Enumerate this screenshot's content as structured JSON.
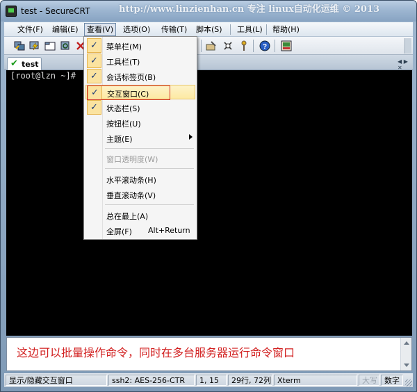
{
  "window": {
    "title": "test - SecureCRT",
    "watermark": "http://www.linzienhan.cn   专注 linux自动化运维 © 2013"
  },
  "menubar": {
    "items": [
      {
        "label": "文件(F)"
      },
      {
        "label": "编辑(E)"
      },
      {
        "label": "查看(V)"
      },
      {
        "label": "选项(O)"
      },
      {
        "label": "传输(T)"
      },
      {
        "label": "脚本(S)"
      },
      {
        "label": "工具(L)"
      },
      {
        "label": "帮助(H)"
      }
    ],
    "active_index": 2
  },
  "toolbar": {
    "icons": [
      "connect-icon",
      "quick-connect-icon",
      "connect-in-tab-icon",
      "reconnect-icon",
      "disconnect-icon",
      "options-icon",
      "key-icon",
      "help-icon",
      "keymap-icon"
    ]
  },
  "tabs": [
    {
      "label": "test",
      "status": "connected"
    }
  ],
  "terminal": {
    "prompt": "[root@lzn ~]#"
  },
  "view_menu": {
    "items": [
      {
        "type": "item",
        "label": "菜单栏(M)",
        "checked": true
      },
      {
        "type": "item",
        "label": "工具栏(T)",
        "checked": true
      },
      {
        "type": "item",
        "label": "会话标签页(B)",
        "checked": true
      },
      {
        "type": "item",
        "label": "交互窗口(C)",
        "checked": true,
        "highlighted": true
      },
      {
        "type": "item",
        "label": "状态栏(S)",
        "checked": true
      },
      {
        "type": "item",
        "label": "按钮栏(U)",
        "checked": false
      },
      {
        "type": "item",
        "label": "主题(E)",
        "checked": false,
        "submenu": true
      },
      {
        "type": "separator"
      },
      {
        "type": "item",
        "label": "窗口透明度(W)",
        "checked": false,
        "disabled": true
      },
      {
        "type": "separator"
      },
      {
        "type": "item",
        "label": "水平滚动条(H)",
        "checked": false
      },
      {
        "type": "item",
        "label": "垂直滚动条(V)",
        "checked": false
      },
      {
        "type": "separator"
      },
      {
        "type": "item",
        "label": "总在最上(A)",
        "checked": false
      },
      {
        "type": "item",
        "label": "全屏(F)",
        "checked": false,
        "shortcut": "Alt+Return"
      }
    ]
  },
  "command_window": {
    "text": "这边可以批量操作命令，同时在多台服务器运行命令窗口"
  },
  "statusbar": {
    "message": "显示/隐藏交互窗口",
    "encryption": "ssh2: AES-256-CTR",
    "cursor": "1,  15",
    "dimensions": "29行, 72列",
    "terminal_type": "Xterm",
    "caps": "大写",
    "num": "数字"
  },
  "colors": {
    "terminal_bg": "#000000",
    "terminal_fg": "#dcdcdc",
    "command_text": "#d22020",
    "check_bg": "#fbe3a0",
    "highlight_border": "#d2312a"
  }
}
